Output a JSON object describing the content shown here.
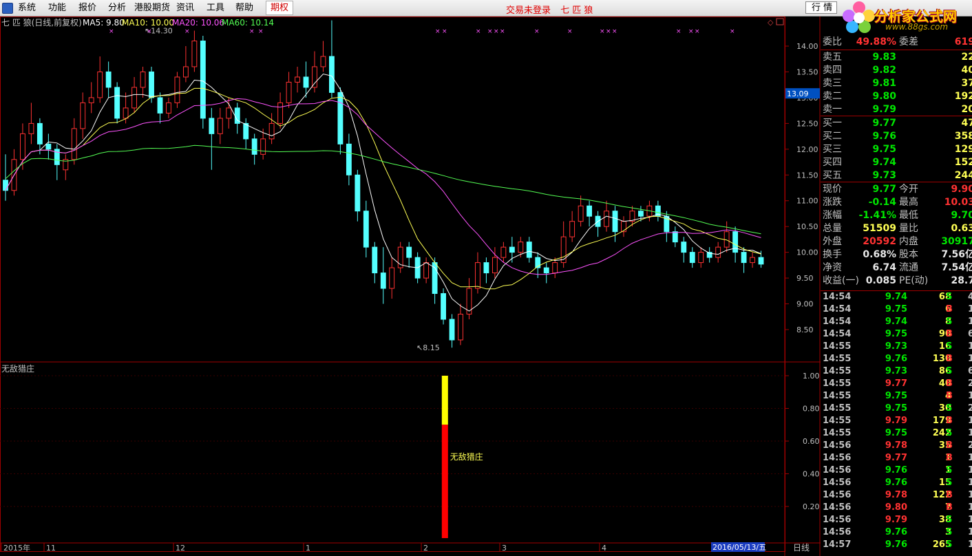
{
  "menu": {
    "items": [
      "系统",
      "功能",
      "报价",
      "分析",
      "港股期货",
      "资讯",
      "工具",
      "帮助"
    ],
    "active_item": "期权",
    "center_status": "交易未登录",
    "center_stock": "七 匹 狼",
    "quote_button": "行 情"
  },
  "logo": {
    "text": "分析家公式网",
    "sub": "www.88gs.com"
  },
  "main_chart": {
    "title": "七 匹 狼(日线,前复权)",
    "ma5": "MA5: 9.80",
    "ma10": "MA10: 10.00",
    "ma20": "MA20: 10.06",
    "ma60": "MA60: 10.14",
    "price_axis": [
      "14.00",
      "13.50",
      "13.00",
      "12.50",
      "12.00",
      "11.50",
      "11.00",
      "10.50",
      "10.00",
      "9.50",
      "9.00",
      "8.50"
    ],
    "current_price_tag": "13.09",
    "high_label": "14.30",
    "low_label": "8.15",
    "colors": {
      "up": "#ff3232",
      "down": "#54ffff",
      "ma5": "#ffffff",
      "ma10": "#ffff54",
      "ma20": "#ff54ff",
      "ma60": "#54ff54"
    }
  },
  "indicator": {
    "name": "无敌猎庄",
    "axis": [
      "1.00",
      "0.80",
      "0.60",
      "0.40",
      "0.20"
    ],
    "signal_label": "无敌猎庄"
  },
  "time_axis": {
    "labels": [
      "2015年",
      "11",
      "12",
      "1",
      "2",
      "3",
      "4"
    ],
    "date_tag": "2016/05/13/五",
    "period": "日线"
  },
  "chart_data": {
    "type": "candlestick",
    "title": "七 匹 狼(日线,前复权)",
    "ylim": [
      8.0,
      14.5
    ],
    "candles": [
      [
        11.4,
        11.2,
        11.9,
        11.0
      ],
      [
        11.2,
        11.8,
        12.0,
        11.1
      ],
      [
        11.8,
        12.3,
        12.5,
        11.6
      ],
      [
        12.3,
        12.5,
        12.9,
        12.1
      ],
      [
        12.5,
        12.1,
        12.6,
        11.9
      ],
      [
        12.1,
        12.0,
        12.3,
        11.8
      ],
      [
        12.0,
        11.7,
        12.1,
        11.4
      ],
      [
        11.6,
        11.8,
        11.9,
        11.4
      ],
      [
        11.8,
        12.4,
        12.6,
        11.7
      ],
      [
        12.4,
        12.9,
        13.1,
        12.2
      ],
      [
        12.9,
        13.0,
        13.3,
        12.7
      ],
      [
        13.0,
        13.5,
        13.8,
        12.9
      ],
      [
        13.5,
        13.2,
        13.7,
        13.0
      ],
      [
        13.2,
        12.6,
        13.3,
        12.5
      ],
      [
        12.6,
        12.8,
        13.1,
        12.5
      ],
      [
        12.8,
        13.2,
        13.4,
        12.7
      ],
      [
        13.2,
        13.5,
        13.6,
        13.0
      ],
      [
        13.5,
        13.0,
        13.6,
        12.9
      ],
      [
        13.0,
        12.7,
        13.1,
        12.5
      ],
      [
        12.7,
        12.9,
        13.0,
        12.6
      ],
      [
        12.9,
        13.4,
        13.5,
        12.8
      ],
      [
        13.4,
        13.6,
        14.0,
        13.3
      ],
      [
        13.6,
        14.1,
        14.3,
        13.5
      ],
      [
        14.1,
        12.6,
        14.2,
        12.4
      ],
      [
        12.6,
        12.3,
        12.8,
        11.6
      ],
      [
        12.3,
        12.6,
        12.8,
        12.1
      ],
      [
        12.6,
        12.8,
        13.0,
        12.4
      ],
      [
        12.8,
        12.5,
        12.9,
        12.3
      ],
      [
        12.5,
        12.2,
        12.6,
        12.0
      ],
      [
        12.2,
        11.9,
        12.3,
        11.7
      ],
      [
        11.9,
        12.2,
        12.4,
        11.8
      ],
      [
        12.2,
        12.5,
        12.7,
        12.1
      ],
      [
        12.5,
        12.9,
        13.1,
        12.4
      ],
      [
        12.9,
        13.3,
        13.5,
        12.8
      ],
      [
        13.3,
        13.4,
        13.6,
        13.1
      ],
      [
        13.4,
        13.2,
        13.7,
        13.0
      ],
      [
        13.2,
        13.6,
        13.9,
        13.1
      ],
      [
        13.6,
        13.8,
        14.1,
        13.5
      ],
      [
        13.8,
        13.1,
        14.5,
        13.0
      ],
      [
        13.1,
        12.1,
        13.2,
        11.9
      ],
      [
        12.1,
        11.5,
        12.3,
        11.3
      ],
      [
        11.5,
        10.8,
        11.6,
        10.6
      ],
      [
        10.8,
        10.1,
        11.0,
        9.9
      ],
      [
        10.1,
        9.6,
        10.2,
        9.4
      ],
      [
        9.6,
        9.3,
        10.1,
        9.0
      ],
      [
        9.3,
        9.7,
        9.9,
        9.1
      ],
      [
        9.7,
        10.1,
        10.2,
        9.6
      ],
      [
        10.1,
        9.9,
        10.2,
        9.7
      ],
      [
        9.9,
        9.5,
        10.0,
        9.4
      ],
      [
        9.5,
        9.8,
        9.9,
        9.4
      ],
      [
        9.8,
        9.2,
        9.9,
        9.0
      ],
      [
        9.2,
        8.7,
        9.3,
        8.6
      ],
      [
        8.7,
        8.3,
        8.8,
        8.15
      ],
      [
        8.3,
        8.8,
        9.0,
        8.2
      ],
      [
        8.8,
        9.3,
        9.5,
        8.7
      ],
      [
        9.3,
        9.8,
        10.0,
        9.2
      ],
      [
        9.8,
        9.6,
        9.9,
        9.4
      ],
      [
        9.6,
        9.9,
        10.1,
        9.5
      ],
      [
        9.9,
        10.1,
        10.2,
        9.8
      ],
      [
        10.1,
        10.0,
        10.3,
        9.8
      ],
      [
        10.0,
        10.2,
        10.3,
        9.9
      ],
      [
        10.2,
        9.9,
        10.3,
        9.8
      ],
      [
        9.9,
        9.7,
        10.0,
        9.5
      ],
      [
        9.7,
        9.6,
        9.8,
        9.4
      ],
      [
        9.6,
        9.8,
        9.9,
        9.5
      ],
      [
        9.8,
        10.3,
        10.6,
        9.7
      ],
      [
        10.3,
        10.6,
        10.8,
        10.2
      ],
      [
        10.6,
        10.9,
        11.1,
        10.5
      ],
      [
        10.9,
        10.7,
        11.0,
        10.5
      ],
      [
        10.7,
        10.5,
        10.8,
        10.3
      ],
      [
        10.5,
        10.8,
        11.0,
        10.4
      ],
      [
        10.8,
        10.4,
        10.9,
        10.2
      ],
      [
        10.4,
        10.6,
        10.7,
        10.3
      ],
      [
        10.6,
        10.8,
        10.9,
        10.5
      ],
      [
        10.8,
        10.7,
        10.9,
        10.6
      ],
      [
        10.7,
        10.9,
        11.0,
        10.6
      ],
      [
        10.9,
        10.7,
        11.0,
        10.6
      ],
      [
        10.7,
        10.4,
        10.8,
        10.2
      ],
      [
        10.4,
        10.2,
        10.5,
        10.1
      ],
      [
        10.2,
        10.0,
        10.3,
        9.8
      ],
      [
        10.0,
        9.8,
        10.1,
        9.7
      ],
      [
        9.8,
        10.0,
        10.1,
        9.7
      ],
      [
        10.0,
        9.9,
        10.1,
        9.8
      ],
      [
        9.9,
        10.1,
        10.2,
        9.8
      ],
      [
        10.1,
        10.4,
        10.6,
        10.0
      ],
      [
        10.4,
        10.0,
        10.5,
        9.8
      ],
      [
        10.0,
        9.8,
        10.1,
        9.6
      ],
      [
        9.8,
        9.9,
        10.0,
        9.7
      ],
      [
        9.9,
        9.77,
        10.03,
        9.7
      ]
    ],
    "indicator_bars": [
      {
        "position": 0.58,
        "red_value": 0.7,
        "yellow_value": 1.0
      }
    ]
  },
  "quote": {
    "weibi_label": "委比",
    "weibi": "49.88%",
    "weicha_label": "委差",
    "weicha": "619",
    "asks": [
      {
        "label": "卖五",
        "price": "9.83",
        "vol": "22"
      },
      {
        "label": "卖四",
        "price": "9.82",
        "vol": "40"
      },
      {
        "label": "卖三",
        "price": "9.81",
        "vol": "37"
      },
      {
        "label": "卖二",
        "price": "9.80",
        "vol": "192"
      },
      {
        "label": "卖一",
        "price": "9.79",
        "vol": "20"
      }
    ],
    "bids": [
      {
        "label": "买一",
        "price": "9.77",
        "vol": "47"
      },
      {
        "label": "买二",
        "price": "9.76",
        "vol": "358"
      },
      {
        "label": "买三",
        "price": "9.75",
        "vol": "129"
      },
      {
        "label": "买四",
        "price": "9.74",
        "vol": "152"
      },
      {
        "label": "买五",
        "price": "9.73",
        "vol": "244"
      }
    ],
    "stats": [
      {
        "l1": "现价",
        "v1": "9.77",
        "c1": "green",
        "l2": "今开",
        "v2": "9.90",
        "c2": "red"
      },
      {
        "l1": "涨跌",
        "v1": "-0.14",
        "c1": "green",
        "l2": "最高",
        "v2": "10.03",
        "c2": "red"
      },
      {
        "l1": "涨幅",
        "v1": "-1.41%",
        "c1": "green",
        "l2": "最低",
        "v2": "9.70",
        "c2": "green"
      },
      {
        "l1": "总量",
        "v1": "51509",
        "c1": "yellow",
        "l2": "量比",
        "v2": "0.63",
        "c2": "yellow"
      },
      {
        "l1": "外盘",
        "v1": "20592",
        "c1": "red",
        "l2": "内盘",
        "v2": "30917",
        "c2": "green"
      },
      {
        "l1": "换手",
        "v1": "0.68%",
        "c1": "white",
        "l2": "股本",
        "v2": "7.56亿",
        "c2": "white"
      },
      {
        "l1": "净资",
        "v1": "6.74",
        "c1": "white",
        "l2": "流通",
        "v2": "7.54亿",
        "c2": "white"
      },
      {
        "l1": "收益(一)",
        "v1": "0.085",
        "c1": "white",
        "l2": "PE(动)",
        "v2": "28.7",
        "c2": "white"
      }
    ],
    "ticks": [
      {
        "t": "14:54",
        "p": "9.74",
        "v": "68",
        "s": "S",
        "x": "4"
      },
      {
        "t": "14:54",
        "p": "9.75",
        "v": "6",
        "s": "B",
        "x": "1"
      },
      {
        "t": "14:54",
        "p": "9.74",
        "v": "8",
        "s": "S",
        "x": "1"
      },
      {
        "t": "14:54",
        "p": "9.75",
        "v": "90",
        "s": "B",
        "x": "6"
      },
      {
        "t": "14:55",
        "p": "9.73",
        "v": "16",
        "s": "S",
        "x": "1"
      },
      {
        "t": "14:55",
        "p": "9.76",
        "v": "130",
        "s": "B",
        "x": "1"
      },
      {
        "t": "14:55",
        "p": "9.73",
        "v": "86",
        "s": "S",
        "x": "6"
      },
      {
        "t": "14:55",
        "p": "9.77",
        "v": "40",
        "s": "B",
        "x": "2"
      },
      {
        "t": "14:55",
        "p": "9.75",
        "v": "4",
        "s": "B",
        "x": "1"
      },
      {
        "t": "14:55",
        "p": "9.75",
        "v": "30",
        "s": "S",
        "x": "2"
      },
      {
        "t": "14:55",
        "p": "9.79",
        "v": "179",
        "s": "B",
        "x": "1"
      },
      {
        "t": "14:55",
        "p": "9.75",
        "v": "242",
        "s": "S",
        "x": "1"
      },
      {
        "t": "14:56",
        "p": "9.78",
        "v": "35",
        "s": "B",
        "x": "2"
      },
      {
        "t": "14:56",
        "p": "9.77",
        "v": "1",
        "s": "B",
        "x": "1"
      },
      {
        "t": "14:56",
        "p": "9.76",
        "v": "1",
        "s": "S",
        "x": "1"
      },
      {
        "t": "14:56",
        "p": "9.76",
        "v": "15",
        "s": "S",
        "x": "1"
      },
      {
        "t": "14:56",
        "p": "9.78",
        "v": "122",
        "s": "B",
        "x": "1"
      },
      {
        "t": "14:56",
        "p": "9.80",
        "v": "7",
        "s": "B",
        "x": "1"
      },
      {
        "t": "14:56",
        "p": "9.79",
        "v": "38",
        "s": "S",
        "x": "1"
      },
      {
        "t": "14:56",
        "p": "9.76",
        "v": "3",
        "s": "S",
        "x": "1"
      },
      {
        "t": "14:57",
        "p": "9.76",
        "v": "265",
        "s": "S",
        "x": "1"
      }
    ]
  }
}
